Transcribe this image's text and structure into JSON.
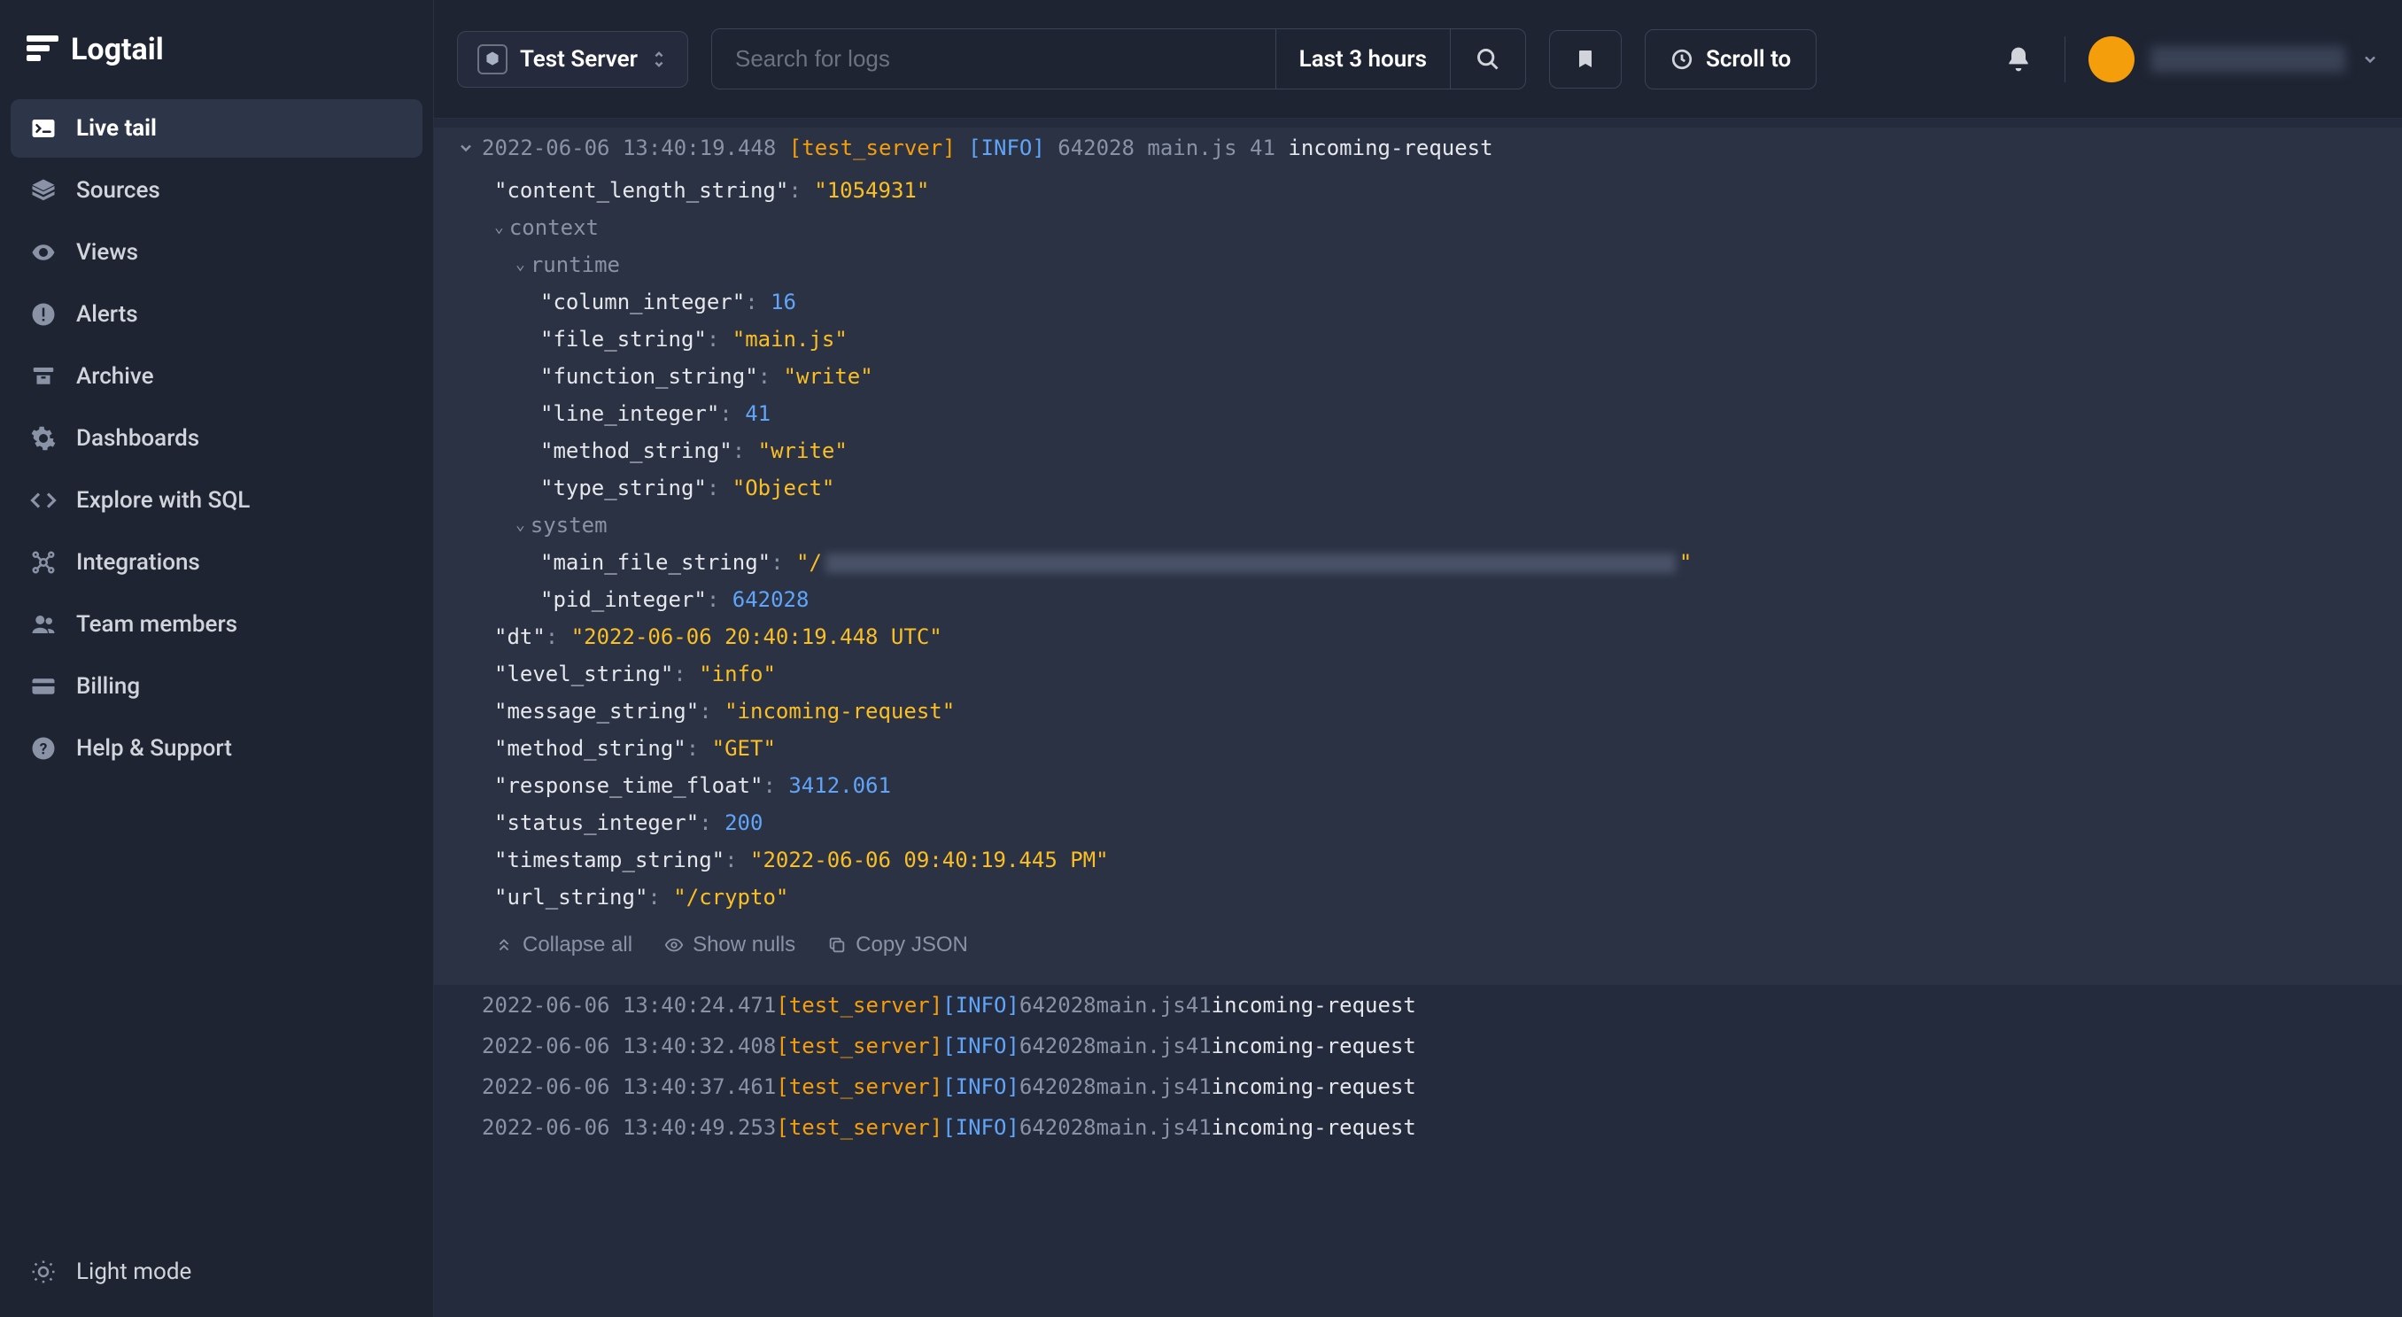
{
  "brand": "Logtail",
  "sidebar": {
    "items": [
      {
        "label": "Live tail"
      },
      {
        "label": "Sources"
      },
      {
        "label": "Views"
      },
      {
        "label": "Alerts"
      },
      {
        "label": "Archive"
      },
      {
        "label": "Dashboards"
      },
      {
        "label": "Explore with SQL"
      },
      {
        "label": "Integrations"
      },
      {
        "label": "Team members"
      },
      {
        "label": "Billing"
      },
      {
        "label": "Help & Support"
      }
    ],
    "footer": {
      "label": "Light mode"
    }
  },
  "topbar": {
    "source": "Test Server",
    "search_placeholder": "Search for logs",
    "range": "Last 3 hours",
    "scroll_to": "Scroll to"
  },
  "expanded_log": {
    "ts": "2022-06-06 13:40:19.448",
    "server": "[test_server]",
    "level": "[INFO]",
    "pid": "642028",
    "file": "main.js",
    "lineno": "41",
    "msg": "incoming-request"
  },
  "detail": {
    "content_length_string": "\"1054931\"",
    "context_label": "context",
    "runtime_label": "runtime",
    "column_integer": "16",
    "file_string": "\"main.js\"",
    "function_string": "\"write\"",
    "line_integer": "41",
    "method_string_rt": "\"write\"",
    "type_string": "\"Object\"",
    "system_label": "system",
    "main_file_string_prefix": "\"/",
    "main_file_string_suffix": "\"",
    "pid_integer": "642028",
    "dt": "\"2022-06-06 20:40:19.448 UTC\"",
    "level_string": "\"info\"",
    "message_string": "\"incoming-request\"",
    "method_string": "\"GET\"",
    "response_time_float": "3412.061",
    "status_integer": "200",
    "timestamp_string": "\"2022-06-06 09:40:19.445 PM\"",
    "url_string": "\"/crypto\""
  },
  "actions": {
    "collapse": "Collapse all",
    "nulls": "Show nulls",
    "copy": "Copy JSON"
  },
  "logs": [
    {
      "ts": "2022-06-06 13:40:24.471",
      "server": "[test_server]",
      "level": "[INFO]",
      "pid": "642028",
      "file": "main.js",
      "lineno": "41",
      "msg": "incoming-request"
    },
    {
      "ts": "2022-06-06 13:40:32.408",
      "server": "[test_server]",
      "level": "[INFO]",
      "pid": "642028",
      "file": "main.js",
      "lineno": "41",
      "msg": "incoming-request"
    },
    {
      "ts": "2022-06-06 13:40:37.461",
      "server": "[test_server]",
      "level": "[INFO]",
      "pid": "642028",
      "file": "main.js",
      "lineno": "41",
      "msg": "incoming-request"
    },
    {
      "ts": "2022-06-06 13:40:49.253",
      "server": "[test_server]",
      "level": "[INFO]",
      "pid": "642028",
      "file": "main.js",
      "lineno": "41",
      "msg": "incoming-request"
    }
  ]
}
